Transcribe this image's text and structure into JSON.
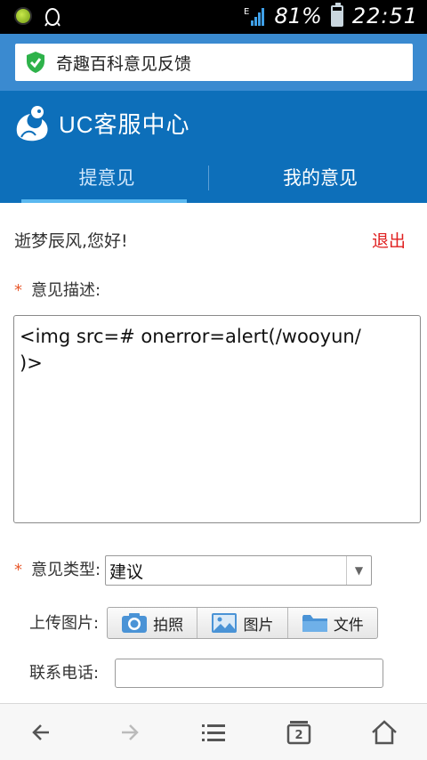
{
  "status_bar": {
    "network_label": "E",
    "battery_percent": "81%",
    "battery_level": 0.81,
    "time": "22:51"
  },
  "address_bar": {
    "url_text": "奇趣百科意见反馈"
  },
  "header": {
    "logo_text": "UC客服中心",
    "tabs": [
      {
        "label": "提意见",
        "active": true
      },
      {
        "label": "我的意见",
        "active": false
      }
    ]
  },
  "user": {
    "greeting": "逝梦辰风,您好!",
    "logout_label": "退出"
  },
  "form": {
    "description": {
      "label": "意见描述:",
      "value": "<img src=# onerror=alert(/wooyun/\n)>"
    },
    "type": {
      "label": "意见类型:",
      "selected": "建议"
    },
    "upload": {
      "label": "上传图片:",
      "buttons": [
        {
          "label": "拍照",
          "icon": "camera-icon"
        },
        {
          "label": "图片",
          "icon": "image-icon"
        },
        {
          "label": "文件",
          "icon": "folder-icon"
        }
      ]
    },
    "phone": {
      "label": "联系电话:",
      "value": ""
    }
  },
  "toolbar": {
    "tab_count": "2"
  },
  "colors": {
    "header_blue": "#0d6fba",
    "address_blue": "#3a8ad0",
    "logout_red": "#e02020",
    "required_orange": "#e85a2e"
  }
}
